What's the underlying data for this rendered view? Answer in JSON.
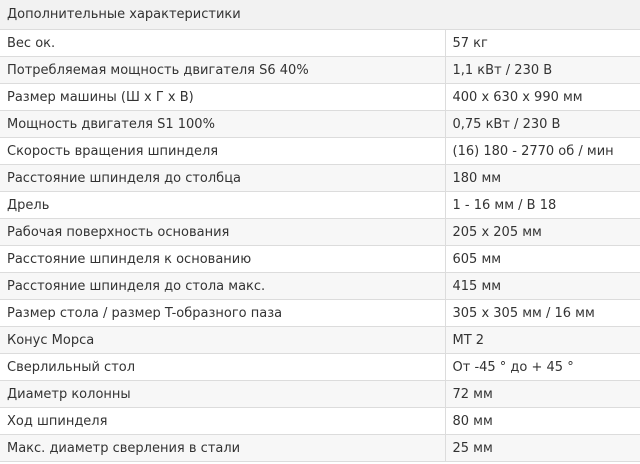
{
  "table": {
    "header": "Дополнительные характеристики",
    "rows": [
      {
        "label": "Вес ок.",
        "value": "57 кг"
      },
      {
        "label": "Потребляемая мощность двигателя S6 40%",
        "value": "1,1 кВт / 230 В"
      },
      {
        "label": "Размер машины (Ш x Г x В)",
        "value": "400 x 630 x 990 мм"
      },
      {
        "label": "Мощность двигателя S1 100%",
        "value": "0,75 кВт / 230 В"
      },
      {
        "label": "Скорость вращения шпинделя",
        "value": "(16) 180 - 2770 об / мин"
      },
      {
        "label": "Расстояние шпинделя до столбца",
        "value": "180 мм"
      },
      {
        "label": "Дрель",
        "value": "1 - 16 мм / В 18"
      },
      {
        "label": "Рабочая поверхность основания",
        "value": "205 x 205 мм"
      },
      {
        "label": "Расстояние шпинделя к основанию",
        "value": "605 мм"
      },
      {
        "label": "Расстояние шпинделя до стола макс.",
        "value": "415 мм"
      },
      {
        "label": "Размер стола / размер T-образного паза",
        "value": "305 x 305 мм / 16 мм"
      },
      {
        "label": "Конус Морса",
        "value": "MT 2"
      },
      {
        "label": "Сверлильный стол",
        "value": "От -45 ° до + 45 °"
      },
      {
        "label": "Диаметр колонны",
        "value": "72 мм"
      },
      {
        "label": "Ход шпинделя",
        "value": "80 мм"
      },
      {
        "label": "Макс. диаметр сверления в стали",
        "value": "25 мм"
      }
    ]
  }
}
